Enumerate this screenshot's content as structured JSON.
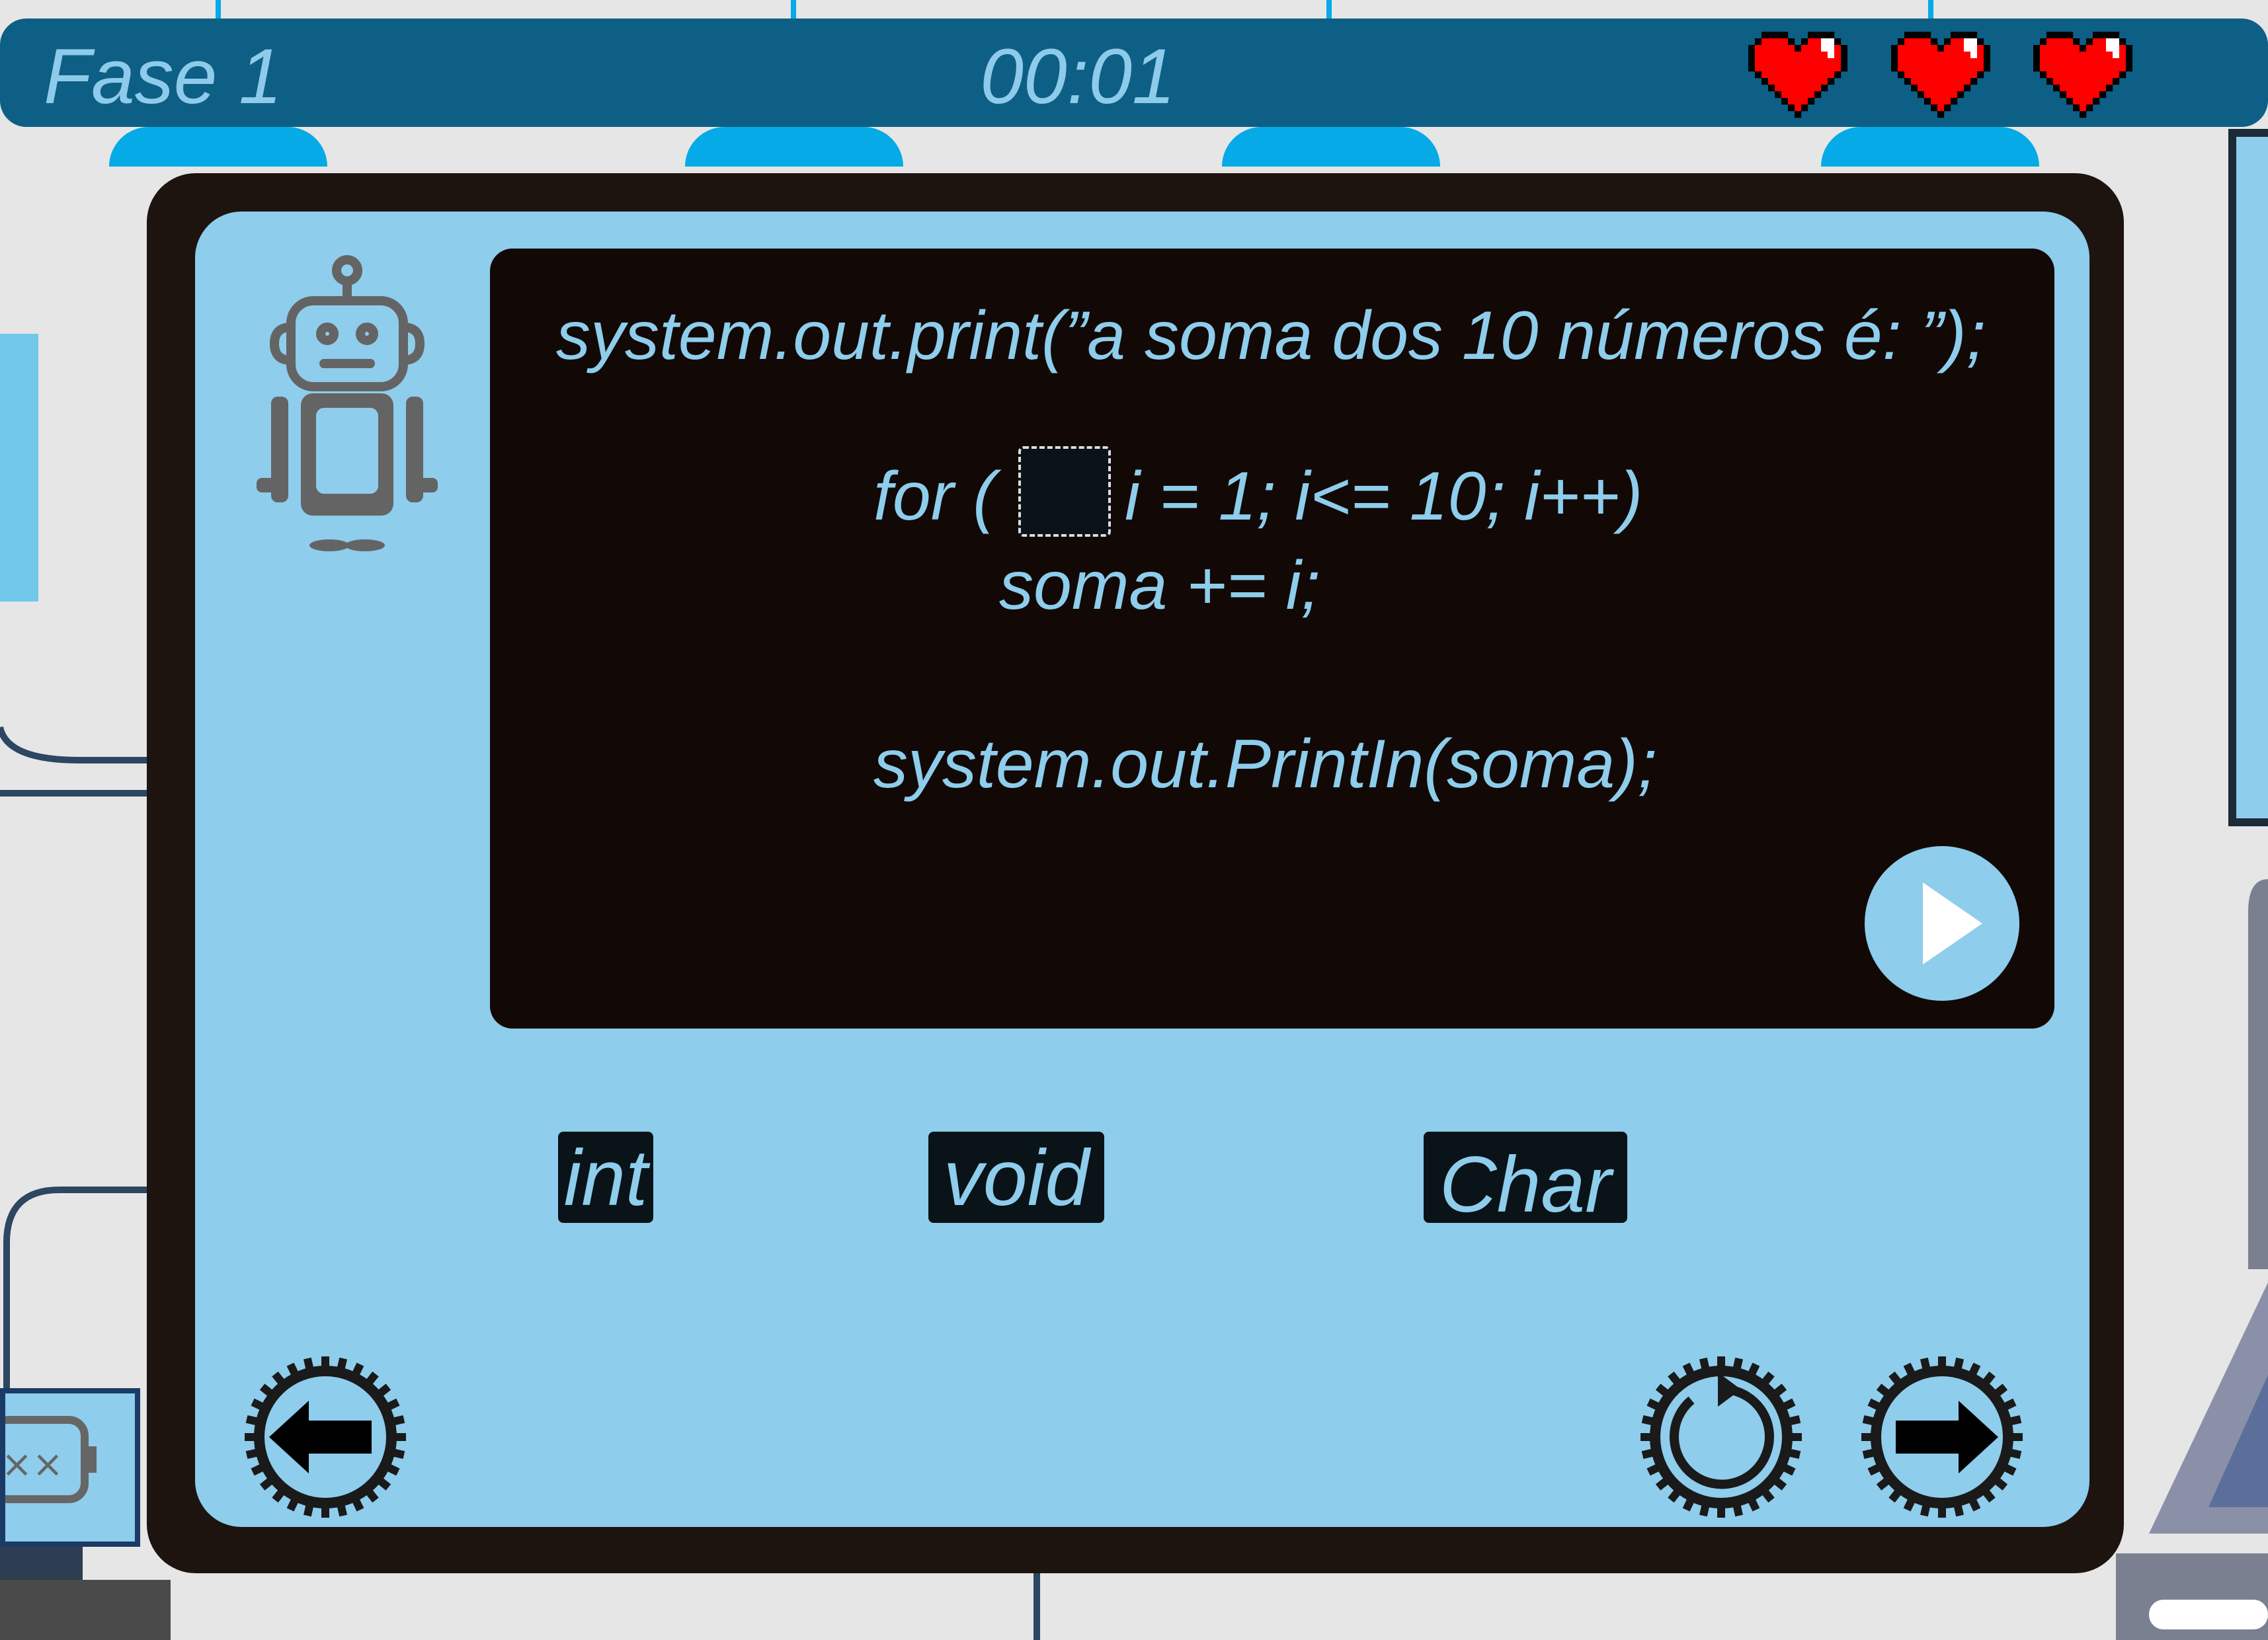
{
  "hud": {
    "phase": "Fase 1",
    "timer": "00:01",
    "lives": 3
  },
  "code": {
    "line1": "system.out.print(”a soma dos 10 números é: ”);",
    "line2_prefix": "for (",
    "line2_suffix": "i = 1; i<= 10; i++)",
    "line3": "soma += i;",
    "line4": "system.out.PrintIn(soma);"
  },
  "options": [
    "int",
    "void",
    "Char"
  ],
  "icons": {
    "avatar": "robot-icon",
    "play": "play-icon",
    "back": "arrow-left-gear-icon",
    "restart": "restart-gear-icon",
    "next": "arrow-right-gear-icon"
  },
  "colors": {
    "hud": "#0d5f85",
    "panel": "#8ecdec",
    "code_bg": "#120907",
    "text": "#8ecdec",
    "heart": "#ff0000"
  }
}
